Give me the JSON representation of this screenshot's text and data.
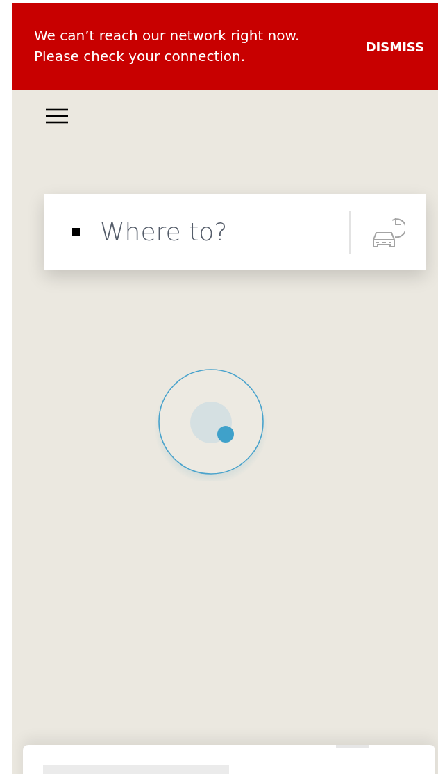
{
  "banner": {
    "message": "We can’t reach our network right now.\nPlease check your connection.",
    "action": "DISMISS"
  },
  "search": {
    "placeholder": "Where to?"
  }
}
